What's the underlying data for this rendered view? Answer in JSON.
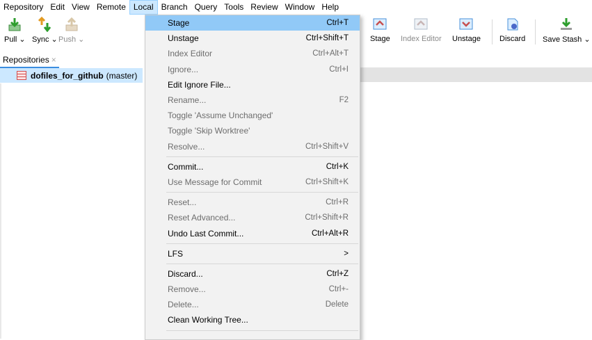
{
  "menubar": {
    "items": [
      "Repository",
      "Edit",
      "View",
      "Remote",
      "Local",
      "Branch",
      "Query",
      "Tools",
      "Review",
      "Window",
      "Help"
    ],
    "active": "Local"
  },
  "toolbar": {
    "pull": "Pull ⌄",
    "sync": "Sync ⌄",
    "push": "Push ⌄",
    "stage": "Stage",
    "index_editor": "Index Editor",
    "unstage": "Unstage",
    "discard": "Discard",
    "save_stash": "Save Stash ⌄"
  },
  "repositories": {
    "tab_label": "Repositories",
    "tab_close": "×",
    "repo_name": "dofiles_for_github",
    "repo_branch": "(master)"
  },
  "local_menu": {
    "items": [
      {
        "label": "Stage",
        "shortcut": "Ctrl+T",
        "disabled": false,
        "highlighted": true
      },
      {
        "label": "Unstage",
        "shortcut": "Ctrl+Shift+T",
        "disabled": false
      },
      {
        "label": "Index Editor",
        "shortcut": "Ctrl+Alt+T",
        "disabled": true
      },
      {
        "label": "Ignore...",
        "shortcut": "Ctrl+I",
        "disabled": true
      },
      {
        "label": "Edit Ignore File...",
        "shortcut": "",
        "disabled": false
      },
      {
        "label": "Rename...",
        "shortcut": "F2",
        "disabled": true
      },
      {
        "label": "Toggle 'Assume Unchanged'",
        "shortcut": "",
        "disabled": true
      },
      {
        "label": "Toggle 'Skip Worktree'",
        "shortcut": "",
        "disabled": true
      },
      {
        "label": "Resolve...",
        "shortcut": "Ctrl+Shift+V",
        "disabled": true
      },
      {
        "label": "Commit...",
        "shortcut": "Ctrl+K",
        "disabled": false
      },
      {
        "label": "Use Message for Commit",
        "shortcut": "Ctrl+Shift+K",
        "disabled": true
      },
      {
        "label": "Reset...",
        "shortcut": "Ctrl+R",
        "disabled": true
      },
      {
        "label": "Reset Advanced...",
        "shortcut": "Ctrl+Shift+R",
        "disabled": true
      },
      {
        "label": "Undo Last Commit...",
        "shortcut": "Ctrl+Alt+R",
        "disabled": false
      },
      {
        "label": "LFS",
        "shortcut": ">",
        "disabled": false
      },
      {
        "label": "Discard...",
        "shortcut": "Ctrl+Z",
        "disabled": false
      },
      {
        "label": "Remove...",
        "shortcut": "Ctrl+-",
        "disabled": true
      },
      {
        "label": "Delete...",
        "shortcut": "Delete",
        "disabled": true
      },
      {
        "label": "Clean Working Tree...",
        "shortcut": "",
        "disabled": false
      }
    ]
  },
  "colors": {
    "highlight": "#91c9f7",
    "selection": "#cce8ff",
    "menu_bg": "#f2f2f2",
    "accent": "#3b8de0"
  }
}
